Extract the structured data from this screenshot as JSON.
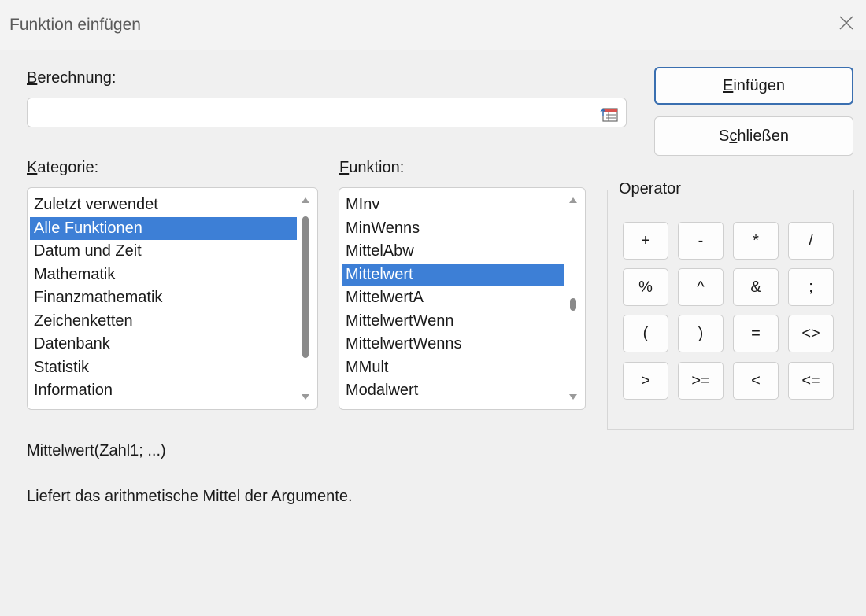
{
  "window": {
    "title": "Funktion einfügen"
  },
  "formula": {
    "label_underlined": "B",
    "label_rest": "erechnung:",
    "value": ""
  },
  "buttons": {
    "insert_underlined": "E",
    "insert_rest": "infügen",
    "close_pre": "S",
    "close_underlined": "c",
    "close_rest": "hließen"
  },
  "category": {
    "label_underlined": "K",
    "label_rest": "ategorie:",
    "items": [
      "Zuletzt verwendet",
      "Alle Funktionen",
      "Datum und Zeit",
      "Mathematik",
      "Finanzmathematik",
      "Zeichenketten",
      "Datenbank",
      "Statistik",
      "Information"
    ],
    "selected": "Alle Funktionen",
    "scroll_position": 0.2
  },
  "function": {
    "label_underlined": "F",
    "label_rest": "unktion:",
    "items": [
      "MInv",
      "MinWenns",
      "MittelAbw",
      "Mittelwert",
      "MittelwertA",
      "MittelwertWenn",
      "MittelwertWenns",
      "MMult",
      "Modalwert"
    ],
    "selected": "Mittelwert",
    "scroll_position": 0.55
  },
  "operator": {
    "label": "Operator",
    "buttons": [
      "+",
      "-",
      "*",
      "/",
      "%",
      "^",
      "&",
      ";",
      "(",
      ")",
      "=",
      "<>",
      ">",
      ">=",
      "<",
      "<="
    ]
  },
  "details": {
    "signature": "Mittelwert(Zahl1; ...)",
    "description": "Liefert das arithmetische Mittel der Argumente."
  }
}
